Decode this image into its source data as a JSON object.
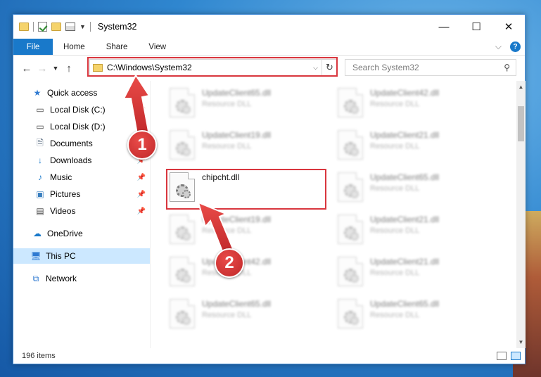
{
  "window": {
    "title": "System32",
    "caption": {
      "minimize": "—",
      "maximize": "☐",
      "close": "✕"
    }
  },
  "ribbon": {
    "tabs": [
      "File",
      "Home",
      "Share",
      "View"
    ],
    "help": "?"
  },
  "navigation": {
    "address": "C:\\Windows\\System32",
    "search_placeholder": "Search System32"
  },
  "sidebar": {
    "items": [
      {
        "label": "Quick access",
        "icon": "star-icon"
      },
      {
        "label": "Local Disk (C:)",
        "icon": "drive-icon",
        "pinned": true
      },
      {
        "label": "Local Disk (D:)",
        "icon": "drive-icon",
        "pinned": true
      },
      {
        "label": "Documents",
        "icon": "documents-icon",
        "pinned": true
      },
      {
        "label": "Downloads",
        "icon": "download-icon",
        "pinned": true
      },
      {
        "label": "Music",
        "icon": "music-icon",
        "pinned": true
      },
      {
        "label": "Pictures",
        "icon": "pictures-icon",
        "pinned": true
      },
      {
        "label": "Videos",
        "icon": "videos-icon",
        "pinned": true
      },
      {
        "label": "OneDrive",
        "icon": "cloud-icon"
      },
      {
        "label": "This PC",
        "icon": "computer-icon",
        "selected": true
      },
      {
        "label": "Network",
        "icon": "network-icon"
      }
    ]
  },
  "files": [
    {
      "name": "UpdateClient65.dll",
      "type": "Resource DLL",
      "blurred": true
    },
    {
      "name": "UpdateClient42.dll",
      "type": "Resource DLL",
      "blurred": true
    },
    {
      "name": "UpdateClient19.dll",
      "type": "Resource DLL",
      "blurred": true
    },
    {
      "name": "UpdateClient21.dll",
      "type": "Resource DLL",
      "blurred": true
    },
    {
      "name": "chipcht.dll",
      "type": "",
      "blurred": false
    },
    {
      "name": "UpdateClient65.dll",
      "type": "Resource DLL",
      "blurred": true
    },
    {
      "name": "UpdateClient19.dll",
      "type": "Resource DLL",
      "blurred": true
    },
    {
      "name": "UpdateClient21.dll",
      "type": "Resource DLL",
      "blurred": true
    },
    {
      "name": "UpdateClient42.dll",
      "type": "Resource DLL",
      "blurred": true
    },
    {
      "name": "UpdateClient21.dll",
      "type": "Resource DLL",
      "blurred": true
    },
    {
      "name": "UpdateClient65.dll",
      "type": "Resource DLL",
      "blurred": true
    },
    {
      "name": "UpdateClient65.dll",
      "type": "Resource DLL",
      "blurred": true
    }
  ],
  "status": {
    "items_count": "196 items"
  },
  "callouts": [
    "1",
    "2"
  ],
  "colors": {
    "accent": "#1979ca",
    "highlight": "#d9363e",
    "selection": "#cce8ff"
  }
}
